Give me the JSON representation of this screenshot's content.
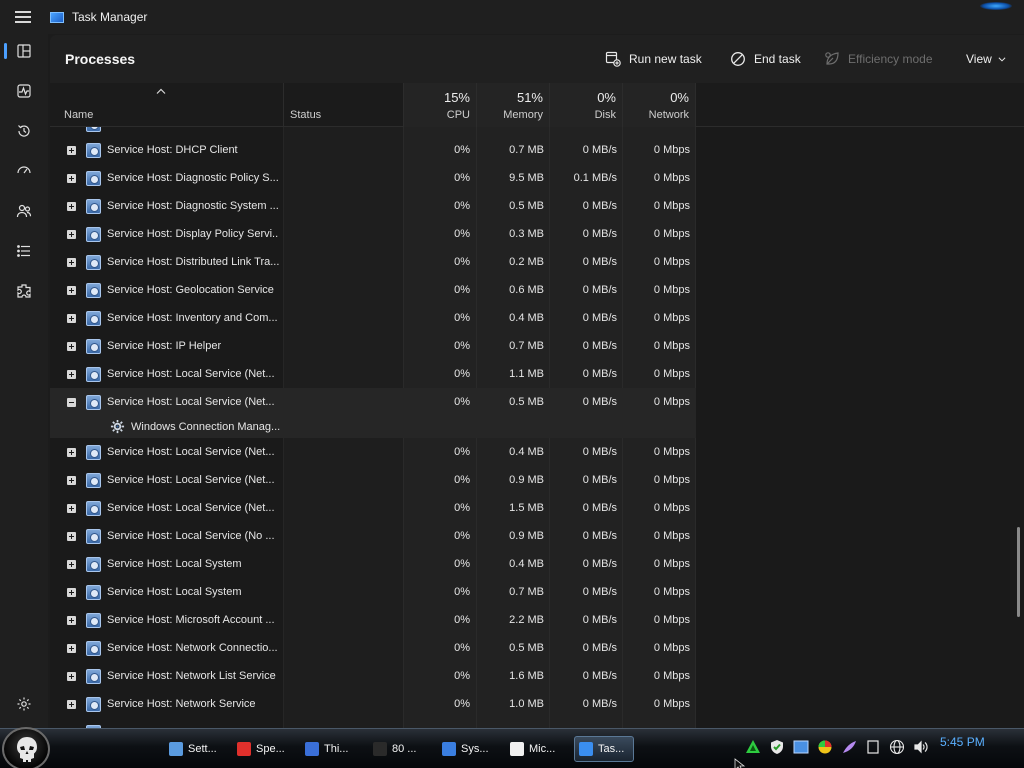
{
  "window": {
    "title": "Task Manager"
  },
  "nav": {
    "items": [
      {
        "name": "processes",
        "icon": "processes-icon"
      },
      {
        "name": "performance",
        "icon": "performance-icon"
      },
      {
        "name": "app-history",
        "icon": "history-icon"
      },
      {
        "name": "startup-apps",
        "icon": "startup-icon"
      },
      {
        "name": "users",
        "icon": "users-icon"
      },
      {
        "name": "details",
        "icon": "details-icon"
      },
      {
        "name": "services",
        "icon": "services-icon"
      }
    ],
    "settings_icon": "settings-icon"
  },
  "commandbar": {
    "page_title": "Processes",
    "run_new_task": "Run new task",
    "end_task": "End task",
    "efficiency_mode": "Efficiency mode",
    "view": "View"
  },
  "columns": {
    "name": "Name",
    "status": "Status",
    "cpu": {
      "pct": "15%",
      "label": "CPU"
    },
    "memory": {
      "pct": "51%",
      "label": "Memory"
    },
    "disk": {
      "pct": "0%",
      "label": "Disk"
    },
    "network": {
      "pct": "0%",
      "label": "Network"
    }
  },
  "rows": [
    {
      "name": "Service Host: DHCP Client",
      "cpu": "0%",
      "memory": "0.7 MB",
      "disk": "0 MB/s",
      "network": "0 Mbps",
      "expanded": false
    },
    {
      "name": "Service Host: Diagnostic Policy S...",
      "cpu": "0%",
      "memory": "9.5 MB",
      "disk": "0.1 MB/s",
      "network": "0 Mbps",
      "expanded": false
    },
    {
      "name": "Service Host: Diagnostic System ...",
      "cpu": "0%",
      "memory": "0.5 MB",
      "disk": "0 MB/s",
      "network": "0 Mbps",
      "expanded": false
    },
    {
      "name": "Service Host: Display Policy Servi...",
      "cpu": "0%",
      "memory": "0.3 MB",
      "disk": "0 MB/s",
      "network": "0 Mbps",
      "expanded": false
    },
    {
      "name": "Service Host: Distributed Link Tra...",
      "cpu": "0%",
      "memory": "0.2 MB",
      "disk": "0 MB/s",
      "network": "0 Mbps",
      "expanded": false
    },
    {
      "name": "Service Host: Geolocation Service",
      "cpu": "0%",
      "memory": "0.6 MB",
      "disk": "0 MB/s",
      "network": "0 Mbps",
      "expanded": false
    },
    {
      "name": "Service Host: Inventory and Com...",
      "cpu": "0%",
      "memory": "0.4 MB",
      "disk": "0 MB/s",
      "network": "0 Mbps",
      "expanded": false
    },
    {
      "name": "Service Host: IP Helper",
      "cpu": "0%",
      "memory": "0.7 MB",
      "disk": "0 MB/s",
      "network": "0 Mbps",
      "expanded": false
    },
    {
      "name": "Service Host: Local Service (Net...",
      "cpu": "0%",
      "memory": "1.1 MB",
      "disk": "0 MB/s",
      "network": "0 Mbps",
      "expanded": false
    },
    {
      "name": "Service Host: Local Service (Net...",
      "cpu": "0%",
      "memory": "0.5 MB",
      "disk": "0 MB/s",
      "network": "0 Mbps",
      "expanded": true,
      "child": "Windows Connection Manag..."
    },
    {
      "name": "Service Host: Local Service (Net...",
      "cpu": "0%",
      "memory": "0.4 MB",
      "disk": "0 MB/s",
      "network": "0 Mbps",
      "expanded": false
    },
    {
      "name": "Service Host: Local Service (Net...",
      "cpu": "0%",
      "memory": "0.9 MB",
      "disk": "0 MB/s",
      "network": "0 Mbps",
      "expanded": false
    },
    {
      "name": "Service Host: Local Service (Net...",
      "cpu": "0%",
      "memory": "1.5 MB",
      "disk": "0 MB/s",
      "network": "0 Mbps",
      "expanded": false
    },
    {
      "name": "Service Host: Local Service (No ...",
      "cpu": "0%",
      "memory": "0.9 MB",
      "disk": "0 MB/s",
      "network": "0 Mbps",
      "expanded": false
    },
    {
      "name": "Service Host: Local System",
      "cpu": "0%",
      "memory": "0.4 MB",
      "disk": "0 MB/s",
      "network": "0 Mbps",
      "expanded": false
    },
    {
      "name": "Service Host: Local System",
      "cpu": "0%",
      "memory": "0.7 MB",
      "disk": "0 MB/s",
      "network": "0 Mbps",
      "expanded": false
    },
    {
      "name": "Service Host: Microsoft Account ...",
      "cpu": "0%",
      "memory": "2.2 MB",
      "disk": "0 MB/s",
      "network": "0 Mbps",
      "expanded": false
    },
    {
      "name": "Service Host: Network Connectio...",
      "cpu": "0%",
      "memory": "0.5 MB",
      "disk": "0 MB/s",
      "network": "0 Mbps",
      "expanded": false
    },
    {
      "name": "Service Host: Network List Service",
      "cpu": "0%",
      "memory": "1.6 MB",
      "disk": "0 MB/s",
      "network": "0 Mbps",
      "expanded": false
    },
    {
      "name": "Service Host: Network Service",
      "cpu": "0%",
      "memory": "1.0 MB",
      "disk": "0 MB/s",
      "network": "0 Mbps",
      "expanded": false
    }
  ],
  "taskbar": {
    "buttons": [
      {
        "label": "Sett...",
        "icon": "settings-gear-icon",
        "color": "#5a9be0"
      },
      {
        "label": "Spe...",
        "icon": "opera-icon",
        "color": "#e0302c"
      },
      {
        "label": "Thi...",
        "icon": "this-pc-icon",
        "color": "#3a6fd8"
      },
      {
        "label": "80 ...",
        "icon": "shield-icon",
        "color": "#2a2a2a"
      },
      {
        "label": "Sys...",
        "icon": "system-icon",
        "color": "#3a7ee0"
      },
      {
        "label": "Mic...",
        "icon": "microsoft-store-icon",
        "color": "#f0f0f0"
      },
      {
        "label": "Tas...",
        "icon": "task-manager-icon",
        "color": "#3a8ef0"
      }
    ],
    "clock": "5:45 PM"
  }
}
